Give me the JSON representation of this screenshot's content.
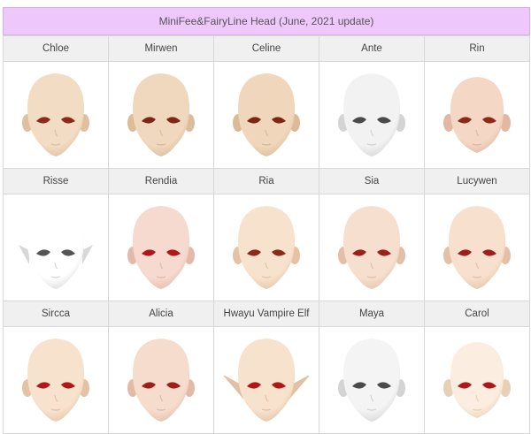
{
  "title": "MiniFee&FairyLine Head (June, 2021 update)",
  "rows": [
    {
      "heads": [
        {
          "name": "Chloe",
          "skin": "#f2dcc4",
          "shade": "#dfbf9f",
          "eye": "#8c2a18",
          "shape": "normal"
        },
        {
          "name": "Mirwen",
          "skin": "#efd8bd",
          "shade": "#dcbc99",
          "eye": "#7e2514",
          "shape": "normal"
        },
        {
          "name": "Celine",
          "skin": "#f0d7bb",
          "shade": "#dcba95",
          "eye": "#7e2514",
          "shape": "normal"
        },
        {
          "name": "Ante",
          "skin": "#f2f2f2",
          "shade": "#d4d4d4",
          "eye": "#4a4a4a",
          "shape": "normal"
        },
        {
          "name": "Rin",
          "skin": "#f5d7c6",
          "shade": "#e2b8a2",
          "eye": "#8c2a18",
          "shape": "round"
        }
      ]
    },
    {
      "heads": [
        {
          "name": "Risse",
          "skin": "#ffffff",
          "shade": "#d8d8d8",
          "eye": "#555555",
          "shape": "elfish"
        },
        {
          "name": "Rendia",
          "skin": "#f6d9cf",
          "shade": "#e3b9aa",
          "eye": "#b01818",
          "shape": "normal"
        },
        {
          "name": "Ria",
          "skin": "#f7e2cd",
          "shade": "#e3c3a4",
          "eye": "#8c2a18",
          "shape": "normal"
        },
        {
          "name": "Sia",
          "skin": "#f7dfcf",
          "shade": "#e4bfa8",
          "eye": "#9e1e1a",
          "shape": "normal"
        },
        {
          "name": "Lucywen",
          "skin": "#f7e0cd",
          "shade": "#e4c0a6",
          "eye": "#9e1e1a",
          "shape": "normal"
        }
      ]
    },
    {
      "heads": [
        {
          "name": "Sircca",
          "skin": "#f7e2cd",
          "shade": "#e4c2a4",
          "eye": "#b01818",
          "shape": "normal"
        },
        {
          "name": "Alicia",
          "skin": "#f6dccd",
          "shade": "#e2bba8",
          "eye": "#9e1e1a",
          "shape": "normal"
        },
        {
          "name": "Hwayu Vampire Elf",
          "skin": "#f7e2cd",
          "shade": "#e2c0a2",
          "eye": "#b01818",
          "shape": "elf"
        },
        {
          "name": "Maya",
          "skin": "#f4f4f4",
          "shade": "#d4d4d4",
          "eye": "#4a4a4a",
          "shape": "normal"
        },
        {
          "name": "Carol",
          "skin": "#fbeee0",
          "shade": "#e8d0b6",
          "eye": "#b01818",
          "shape": "round"
        }
      ]
    }
  ]
}
